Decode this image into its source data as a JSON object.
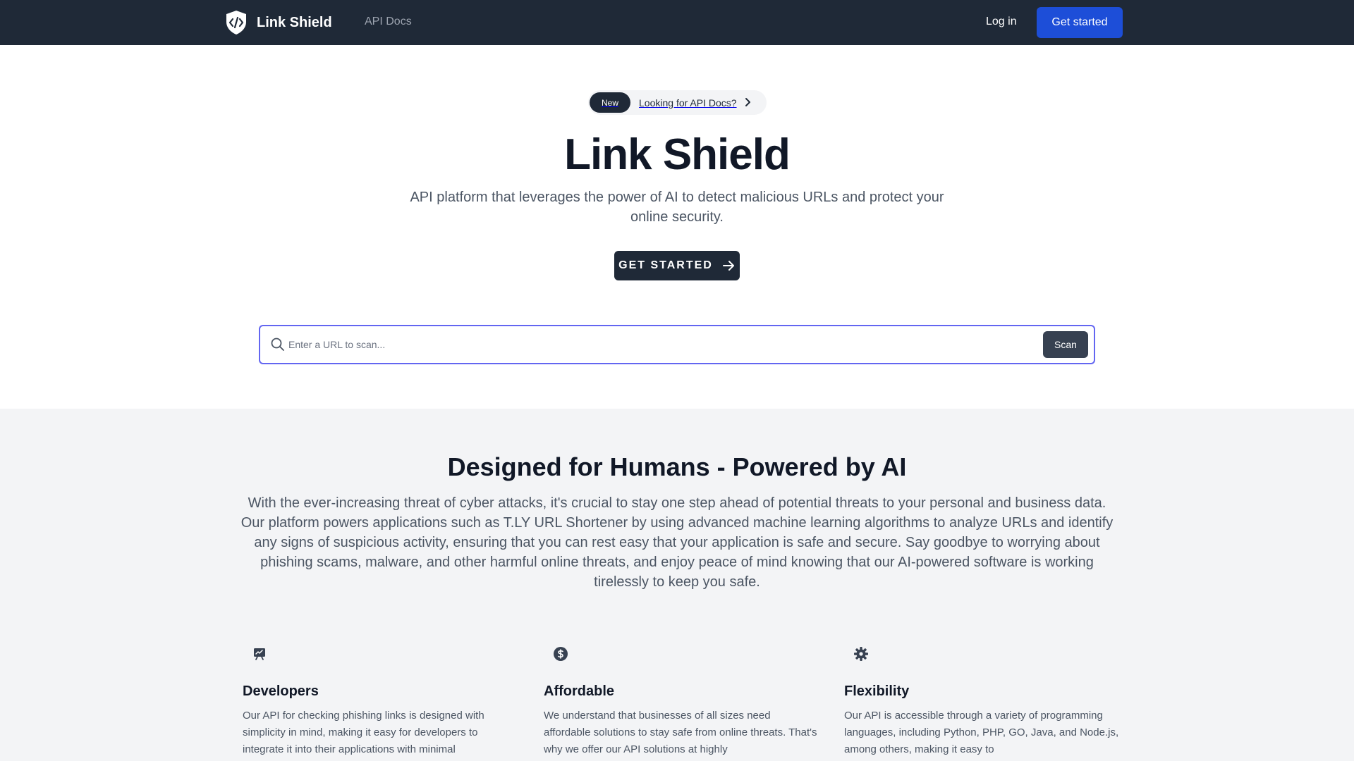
{
  "nav": {
    "brand": "Link Shield",
    "docs_link": "API Docs",
    "login": "Log in",
    "cta": "Get started"
  },
  "hero": {
    "pill_badge": "New",
    "pill_text": "Looking for API Docs?",
    "title": "Link Shield",
    "subtitle": "API platform that leverages the power of AI to detect malicious URLs and protect your online security.",
    "cta": "GET STARTED"
  },
  "search": {
    "placeholder": "Enter a URL to scan...",
    "button": "Scan"
  },
  "features": {
    "title": "Designed for Humans - Powered by AI",
    "body": "With the ever-increasing threat of cyber attacks, it's crucial to stay one step ahead of potential threats to your personal and business data. Our platform powers applications such as T.LY URL Shortener by using advanced machine learning algorithms to analyze URLs and identify any signs of suspicious activity, ensuring that you can rest easy that your application is safe and secure. Say goodbye to worrying about phishing scams, malware, and other harmful online threats, and enjoy peace of mind knowing that our AI-powered software is working tirelessly to keep you safe.",
    "cards": [
      {
        "icon": "presentation-chart-icon",
        "title": "Developers",
        "text": "Our API for checking phishing links is designed with simplicity in mind, making it easy for developers to integrate it into their applications with minimal"
      },
      {
        "icon": "dollar-coin-icon",
        "title": "Affordable",
        "text": "We understand that businesses of all sizes need affordable solutions to stay safe from online threats. That's why we offer our API solutions at highly"
      },
      {
        "icon": "gear-icon",
        "title": "Flexibility",
        "text": "Our API is accessible through a variety of programming languages, including Python, PHP, GO, Java, and Node.js, among others, making it easy to"
      }
    ]
  },
  "colors": {
    "nav_bg": "#1f2937",
    "primary_blue": "#1d4ed8",
    "search_border": "#6366f1",
    "section_bg": "#f3f4f6"
  }
}
